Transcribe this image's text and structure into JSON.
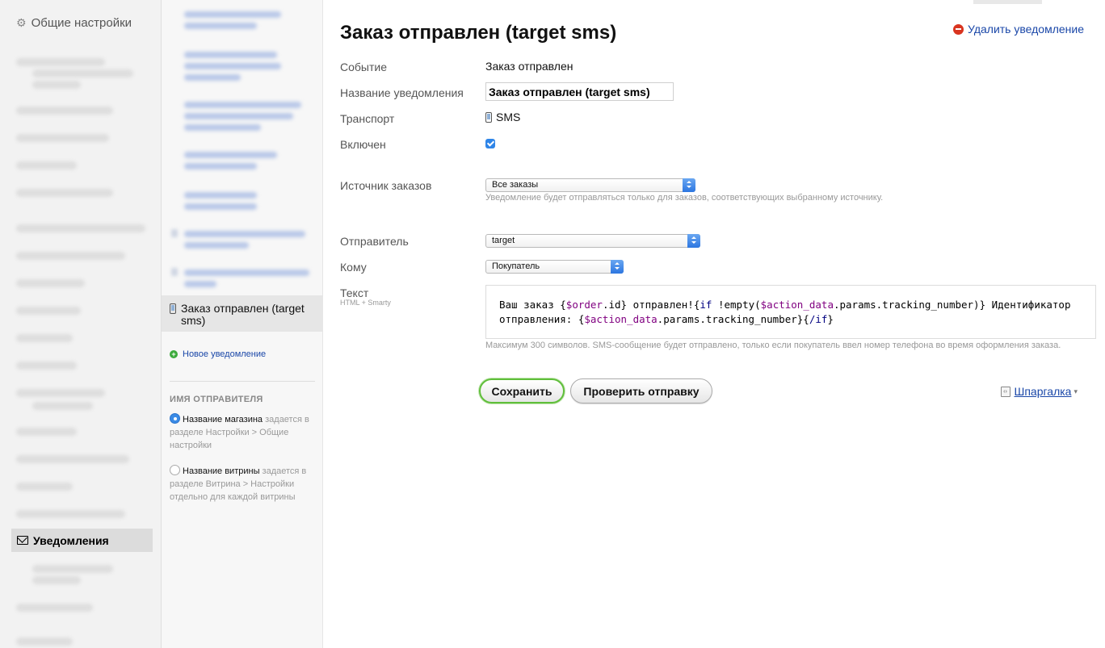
{
  "sidebar": {
    "title": "Общие настройки",
    "active_item": "Уведомления"
  },
  "middle": {
    "active_item": "Заказ отправлен (target sms)",
    "new_notification": "Новое уведомление",
    "sender_name_title": "ИМЯ ОТПРАВИТЕЛЯ",
    "sender_options": [
      {
        "label": "Название магазина",
        "hint": "задается в разделе Настройки > Общие настройки",
        "selected": true
      },
      {
        "label": "Название витрины",
        "hint": "задается в разделе Витрина > Настройки отдельно для каждой витрины",
        "selected": false
      }
    ]
  },
  "main": {
    "title": "Заказ отправлен (target sms)",
    "delete_link": "Удалить уведомление",
    "fields": {
      "event_label": "Событие",
      "event_value": "Заказ отправлен",
      "name_label": "Название уведомления",
      "name_value": "Заказ отправлен (target sms)",
      "transport_label": "Транспорт",
      "transport_value": "SMS",
      "enabled_label": "Включен",
      "enabled": true,
      "source_label": "Источник заказов",
      "source_value": "Все заказы",
      "source_hint": "Уведомление будет отправляться только для заказов, соответствующих выбранному источнику.",
      "sender_label": "Отправитель",
      "sender_value": "target",
      "to_label": "Кому",
      "to_value": "Покупатель",
      "text_label": "Текст",
      "text_sublabel": "HTML + Smarty",
      "text_parts": {
        "p1": "Ваш заказ {",
        "p2": "$order",
        "p3": ".id} отправлен!{",
        "p4": "if",
        "p5": " !empty(",
        "p6": "$action_data",
        "p7": ".params.tracking_number)} Идентификатор отправления: {",
        "p8": "$action_data",
        "p9": ".params.tracking_number}{",
        "p10": "/if",
        "p11": "}"
      },
      "text_hint": "Максимум 300 символов. SMS-сообщение будет отправлено, только если покупатель ввел номер телефона во время оформления заказа."
    },
    "buttons": {
      "save": "Сохранить",
      "test": "Проверить отправку"
    },
    "cheatsheet": "Шпаргалка"
  }
}
